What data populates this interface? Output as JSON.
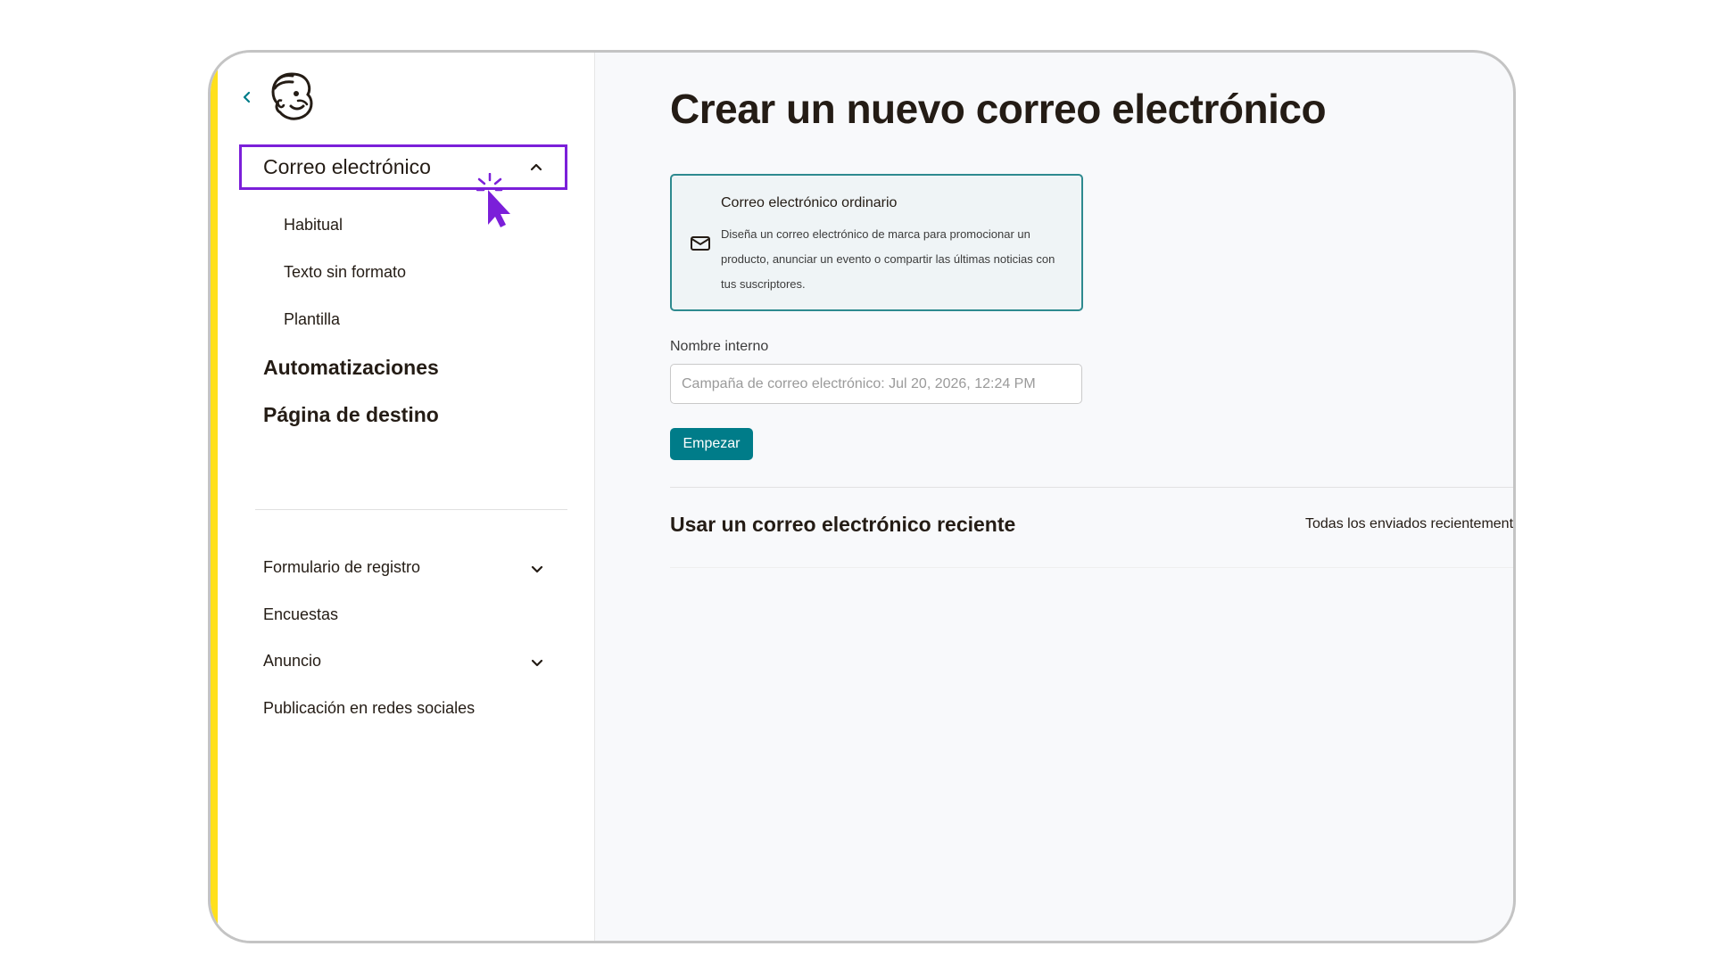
{
  "colors": {
    "accent_teal": "#007c89",
    "highlight_purple": "#7b1fd9",
    "brand_yellow": "#ffe01b",
    "text_dark": "#241c15"
  },
  "sidebar": {
    "back_icon": "chevron-left-icon",
    "logo_icon": "mailchimp-freddie-logo",
    "email": {
      "label": "Correo electrónico",
      "icon": "chevron-up-icon",
      "sub_items": [
        {
          "label": "Habitual"
        },
        {
          "label": "Texto sin formato"
        },
        {
          "label": "Plantilla"
        }
      ]
    },
    "primary_items": [
      {
        "label": "Automatizaciones"
      },
      {
        "label": "Página de destino"
      }
    ],
    "secondary_items": [
      {
        "label": "Formulario de registro",
        "icon": "chevron-down-icon"
      },
      {
        "label": "Encuestas"
      },
      {
        "label": "Anuncio",
        "icon": "chevron-down-icon"
      },
      {
        "label": "Publicación en redes sociales"
      }
    ]
  },
  "main": {
    "title": "Crear un nuevo correo electrónico",
    "card": {
      "icon": "envelope-icon",
      "title": "Correo electrónico ordinario",
      "description": "Diseña un correo electrónico de marca para promocionar un producto, anunciar un evento o compartir las últimas noticias con tus suscriptores."
    },
    "internal_name": {
      "label": "Nombre interno",
      "placeholder": "Campaña de correo electrónico: Jul 20, 2026, 12:24 PM"
    },
    "start_button": "Empezar",
    "recent_section": {
      "title": "Usar un correo electrónico reciente",
      "link": "Todas los enviados recientemente"
    }
  },
  "cursor_icon": "click-cursor-icon"
}
